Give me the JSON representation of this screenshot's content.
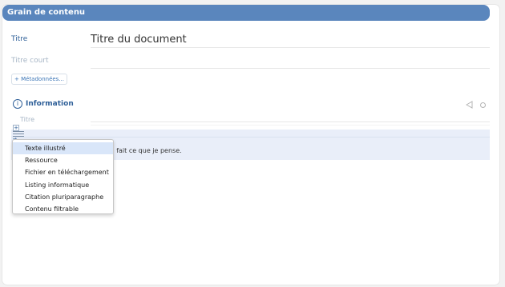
{
  "header": {
    "title": "Grain de contenu"
  },
  "form": {
    "titre_label": "Titre",
    "titre_value": "Titre du document",
    "titre_court_label": "Titre court",
    "metadata_link": "+ Métadonnées..."
  },
  "section": {
    "information_label": "Information",
    "small_title_label": "Titre"
  },
  "content": {
    "row_text": "ut à fait ce que je pense."
  },
  "menu": {
    "items": [
      {
        "label": "Texte illustré",
        "active": true
      },
      {
        "label": "Ressource"
      },
      {
        "label": "Fichier en téléchargement"
      },
      {
        "label": "Listing informatique"
      },
      {
        "label": "Citation pluriparagraphe"
      },
      {
        "label": "Contenu filtrable"
      }
    ]
  },
  "colors": {
    "header_bg": "#5a86bd",
    "accent_text": "#2e5f98",
    "selected_row": "#d9e6f9",
    "content_band": "#e9eef9"
  }
}
